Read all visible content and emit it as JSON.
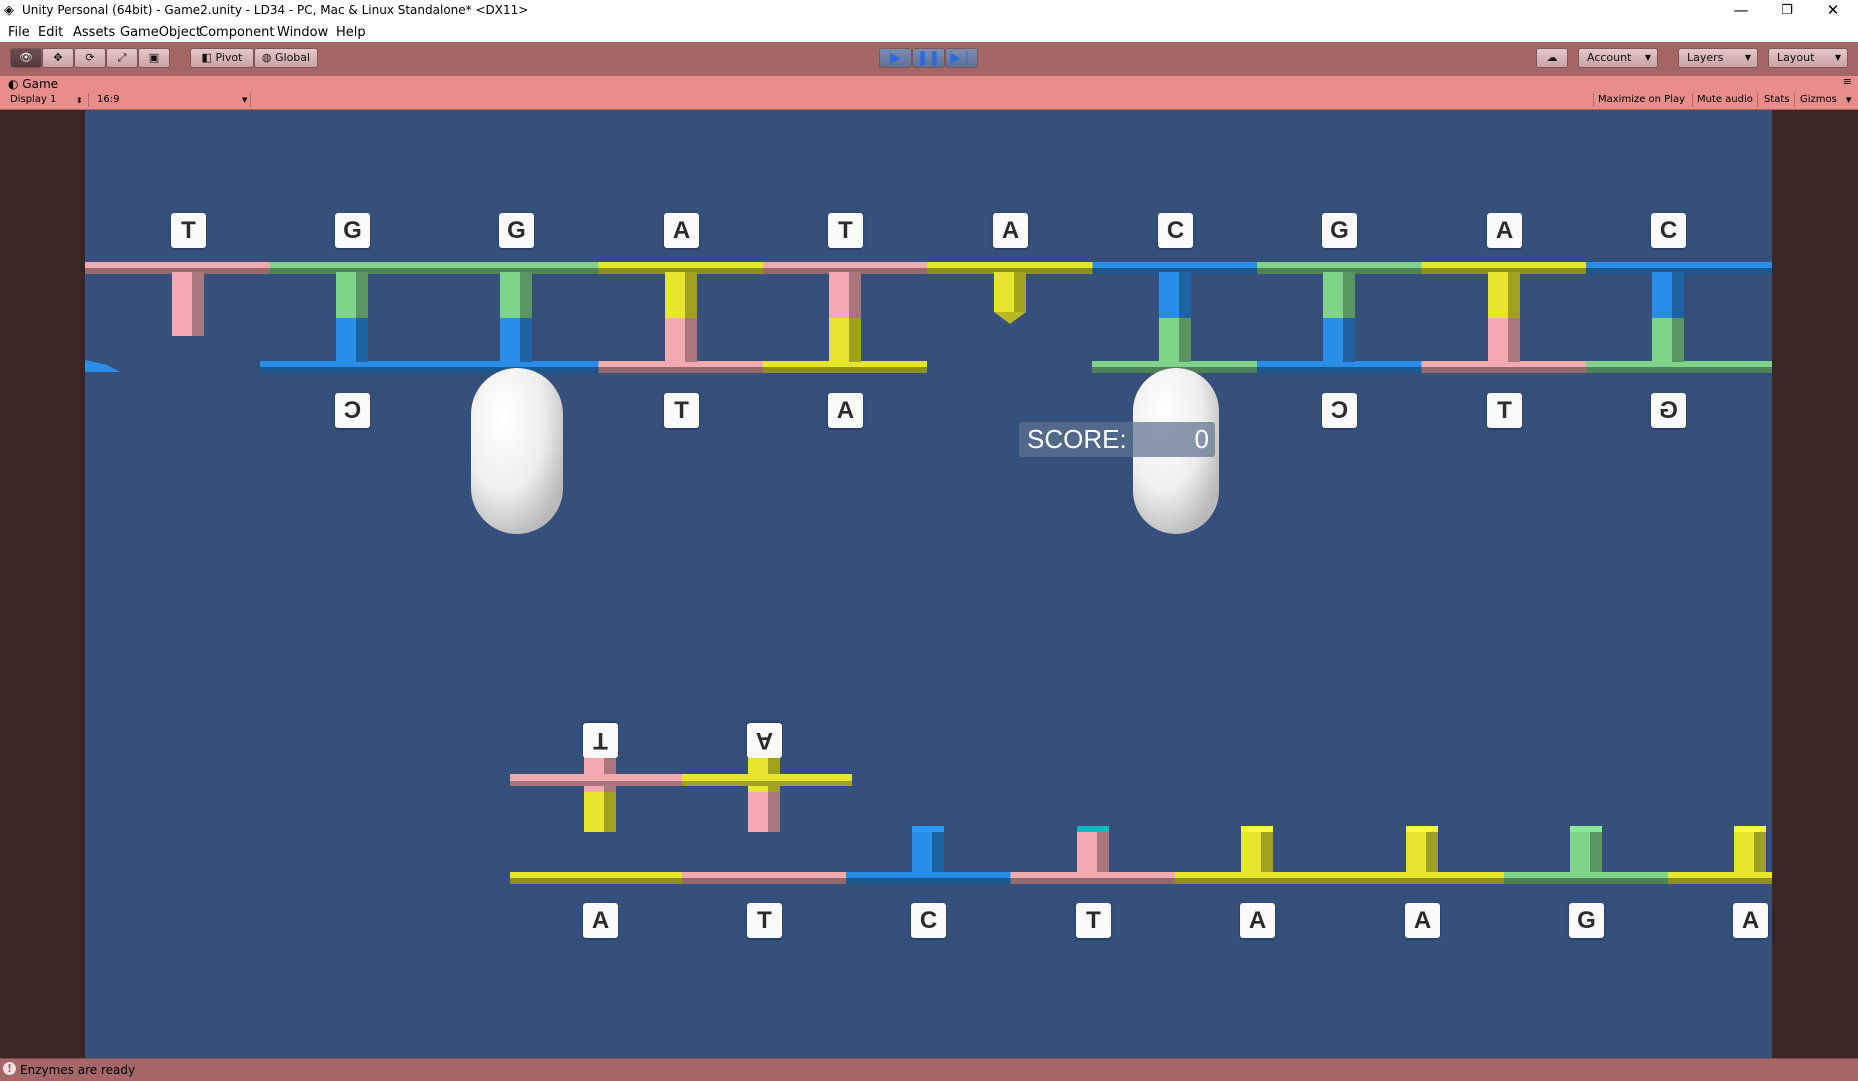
{
  "window": {
    "title": "Unity Personal (64bit) - Game2.unity - LD34 - PC, Mac & Linux Standalone* <DX11>",
    "controls": [
      "—",
      "❐",
      "✕"
    ]
  },
  "menu": [
    "File",
    "Edit",
    "Assets",
    "GameObject",
    "Component",
    "Window",
    "Help"
  ],
  "toolbar": {
    "pivot": "Pivot",
    "global": "Global",
    "account": "Account",
    "layers": "Layers",
    "layout": "Layout"
  },
  "game_tab": {
    "title": "Game",
    "display": "Display 1",
    "aspect": "16:9",
    "maximize": "Maximize on Play",
    "mute": "Mute audio",
    "stats": "Stats",
    "gizmos": "Gizmos"
  },
  "score": {
    "label": "SCORE:",
    "value": "0"
  },
  "dna": {
    "top_letters": [
      "T",
      "G",
      "G",
      "A",
      "T",
      "A",
      "C",
      "G",
      "A",
      "C"
    ],
    "top_complement": [
      "",
      "C",
      "",
      "T",
      "A",
      "",
      "",
      "C",
      "T",
      "G"
    ],
    "bottom_letters": [
      "A",
      "T",
      "C",
      "T",
      "A",
      "A",
      "G",
      "A"
    ],
    "bottom_complement": [
      "T",
      "A"
    ]
  },
  "colors": {
    "A": "#e6e62c",
    "T": "#f2aab0",
    "C": "#2a8ee8",
    "G": "#7fd48a",
    "background": "#34507b",
    "editor": "#a46667"
  },
  "status": {
    "text": "Enzymes are ready"
  }
}
